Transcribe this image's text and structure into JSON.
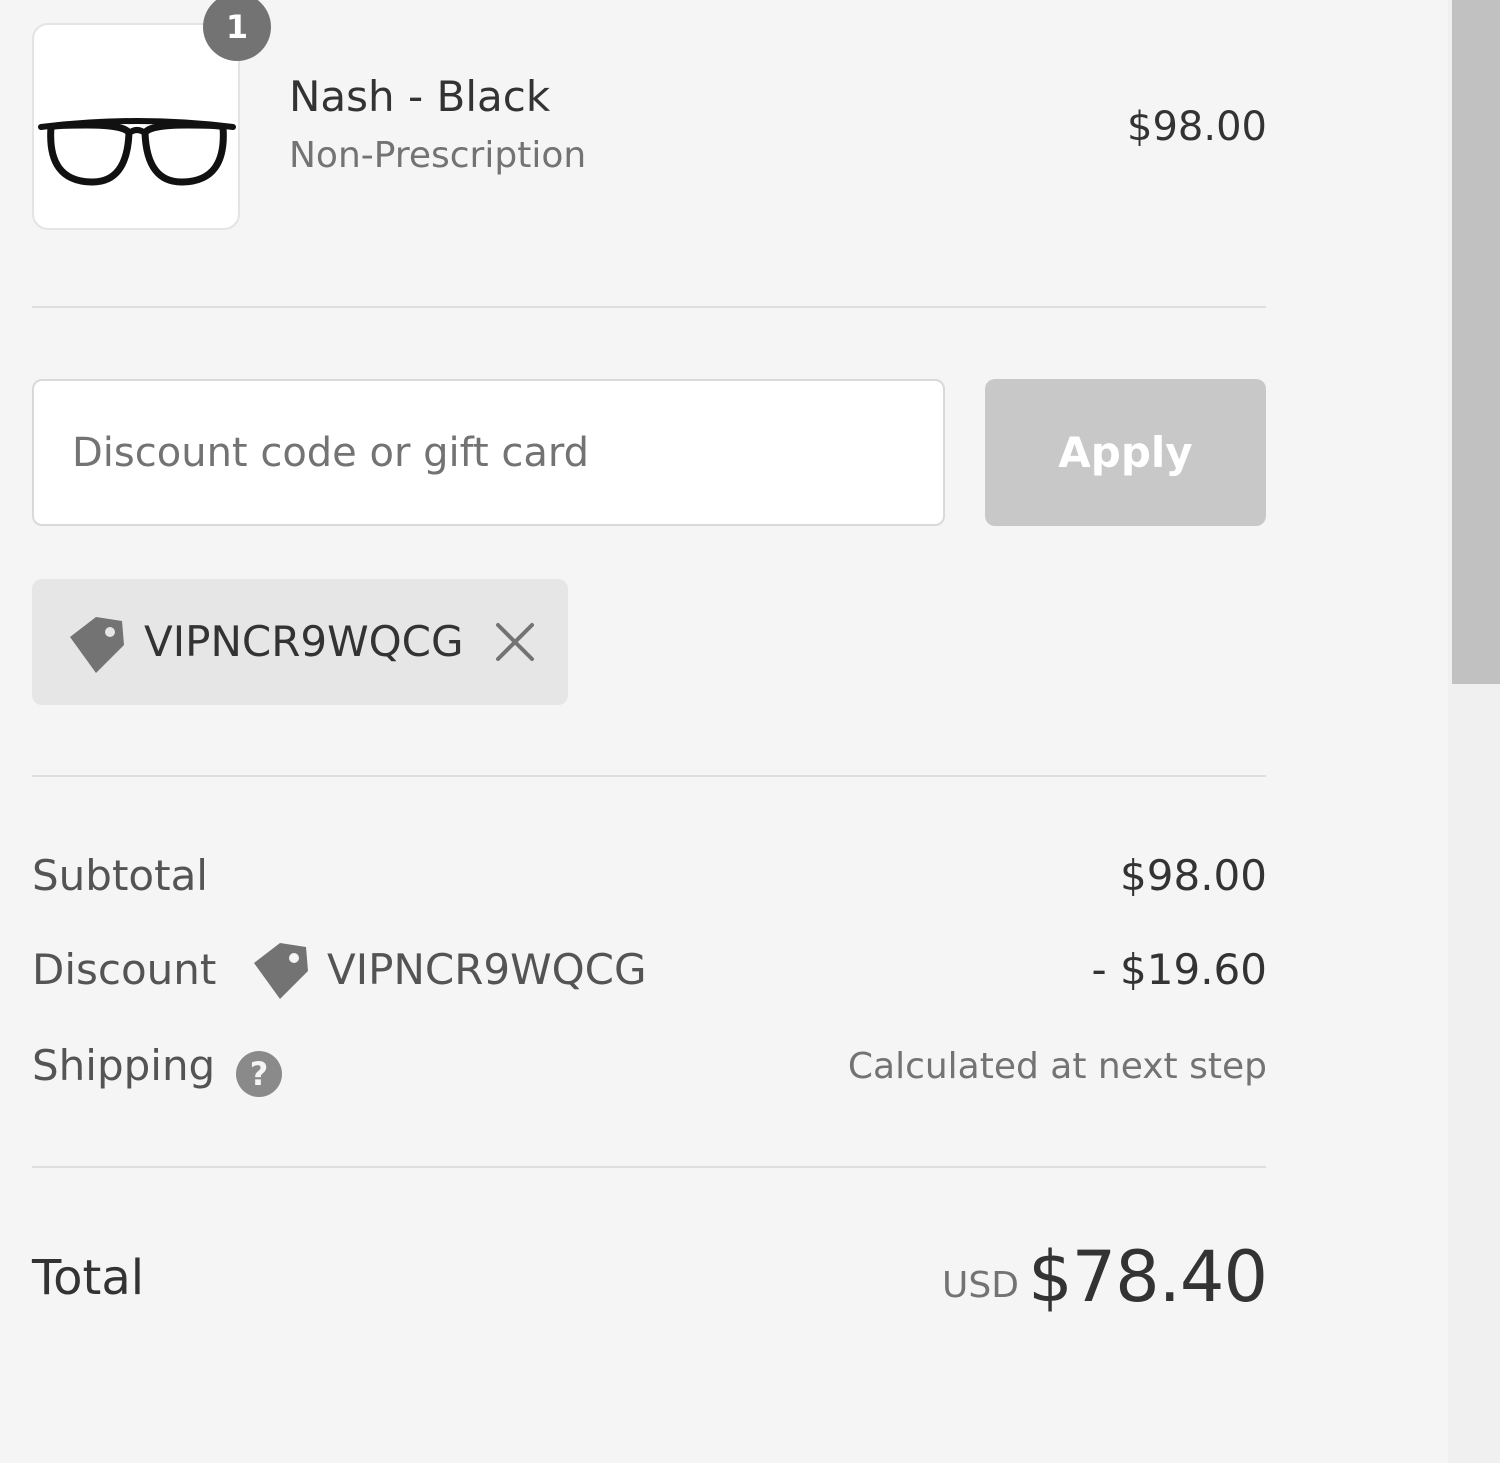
{
  "product": {
    "quantity": "1",
    "name": "Nash - Black",
    "variant": "Non-Prescription",
    "price": "$98.00",
    "image_icon": "eyeglasses-icon"
  },
  "discount_form": {
    "placeholder": "Discount code or gift card",
    "value": "",
    "apply_label": "Apply"
  },
  "applied_discount": {
    "code": "VIPNCR9WQCG",
    "tag_icon": "tag-icon",
    "remove_icon": "close-icon"
  },
  "summary": {
    "subtotal_label": "Subtotal",
    "subtotal_value": "$98.00",
    "discount_label": "Discount",
    "discount_code": "VIPNCR9WQCG",
    "discount_value": "- $19.60",
    "shipping_label": "Shipping",
    "shipping_help": "?",
    "shipping_value": "Calculated at next step",
    "total_label": "Total",
    "total_currency": "USD",
    "total_value": "$78.40"
  },
  "colors": {
    "background": "#f5f5f5",
    "text": "#333333",
    "muted_text": "#737373",
    "button_disabled": "#c8c8c8",
    "chip": "#e6e6e6"
  }
}
